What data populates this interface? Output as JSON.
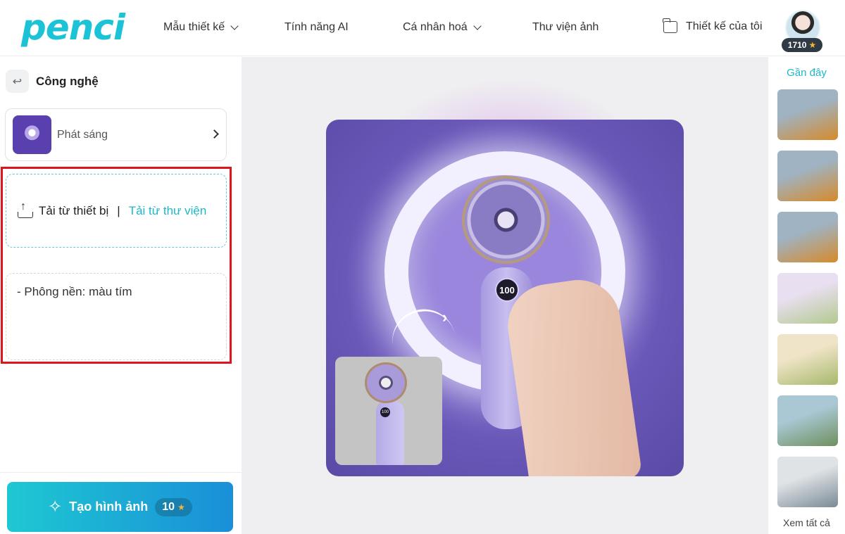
{
  "header": {
    "logo": "penci",
    "nav": [
      {
        "label": "Mẫu thiết kế"
      },
      {
        "label": "Tính năng AI"
      },
      {
        "label": "Cá nhân hoá"
      },
      {
        "label": "Thư viện ảnh"
      }
    ],
    "my_designs": "Thiết kế của tôi",
    "points": "1710"
  },
  "left_panel": {
    "category_title": "Công nghệ",
    "style_name": "Phát sáng",
    "upload_device": "Tải từ thiết bị",
    "separator": "|",
    "upload_library": "Tải từ thư viện",
    "prompt_text": "- Phông nền: màu tím",
    "generate_label": "Tạo hình ảnh",
    "generate_cost": "10"
  },
  "canvas": {
    "display_number": "100",
    "source_display_number": "100"
  },
  "right_panel": {
    "title": "Gần đây",
    "see_all": "Xem tất cả",
    "thumbnails": [
      {
        "name": "robot-boba-1",
        "colors": [
          "#9fb3c2",
          "#d68a2b"
        ]
      },
      {
        "name": "robot-boba-2",
        "colors": [
          "#9fb3c2",
          "#d68a2b"
        ]
      },
      {
        "name": "robot-boba-3",
        "colors": [
          "#9fb3c2",
          "#d68a2b"
        ]
      },
      {
        "name": "matcha-lily",
        "colors": [
          "#e8dff0",
          "#b3c98f"
        ]
      },
      {
        "name": "matcha-drinks",
        "colors": [
          "#efe4c7",
          "#a6b86a"
        ]
      },
      {
        "name": "matcha-beach",
        "colors": [
          "#a9c8d4",
          "#6f8f5f"
        ]
      },
      {
        "name": "laptop",
        "colors": [
          "#dfe3e6",
          "#7a8a95"
        ]
      }
    ]
  },
  "colors": {
    "accent": "#1fb7c9",
    "highlight_box": "#e0141c",
    "generate_gradient_start": "#1ec8d2",
    "generate_gradient_end": "#1a8fd8"
  }
}
